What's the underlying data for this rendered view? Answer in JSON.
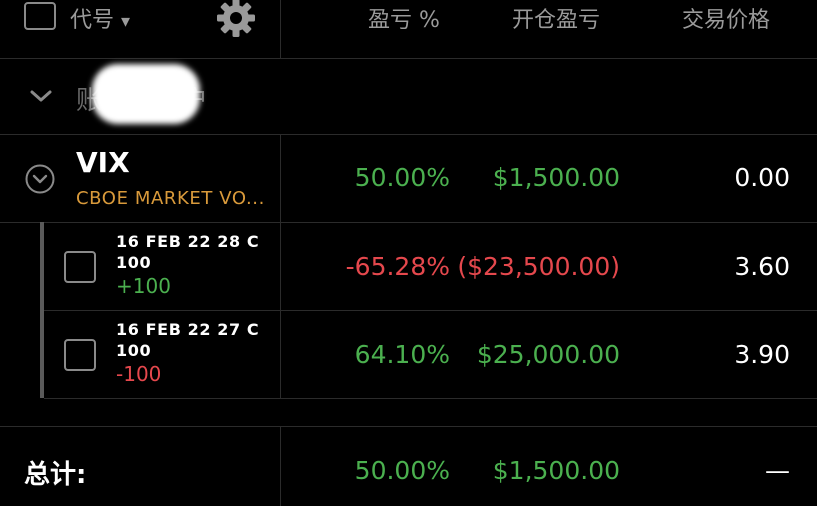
{
  "header": {
    "symbol_label": "代号",
    "symbol_sort_glyph": "▾",
    "settings_icon": "gear-icon",
    "col_pnl_pct": "盈亏 %",
    "col_open_pnl": "开仓盈亏",
    "col_trade_price": "交易价格"
  },
  "account": {
    "prefix": "账",
    "suffix": "户",
    "collapse_icon": "chevron-down-icon"
  },
  "position": {
    "symbol": "VIX",
    "description": "CBOE MARKET VO...",
    "expand_icon": "circle-chevron-down-icon",
    "pnl_pct": "50.00%",
    "open_pnl": "$1,500.00",
    "trade_price": "0.00"
  },
  "legs": [
    {
      "line1": "16 FEB 22 28 C",
      "line2": "100",
      "qty": "+100",
      "pnl_pct": "-65.28%",
      "open_pnl": "($23,500.00)",
      "trade_price": "3.60"
    },
    {
      "line1": "16 FEB 22 27 C",
      "line2": "100",
      "qty": "-100",
      "pnl_pct": "64.10%",
      "open_pnl": "$25,000.00",
      "trade_price": "3.90"
    }
  ],
  "total": {
    "label": "总计:",
    "pnl_pct": "50.00%",
    "open_pnl": "$1,500.00",
    "trade_price": "—"
  },
  "colors": {
    "background": "#000000",
    "positive": "#4bb04f",
    "negative": "#e5484d",
    "description": "#d99a3b",
    "divider": "#2b2b2b"
  }
}
